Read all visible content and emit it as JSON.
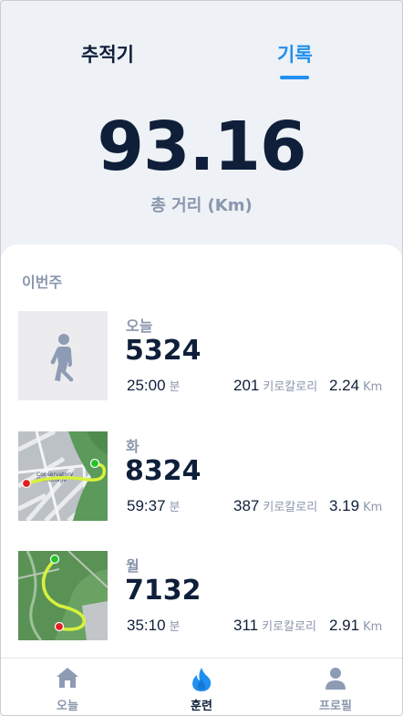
{
  "header": {
    "tabs": [
      {
        "label": "추적기",
        "active": false
      },
      {
        "label": "기록",
        "active": true
      }
    ]
  },
  "summary": {
    "total_distance": "93.16",
    "total_label": "총 거리 (Km)"
  },
  "week": {
    "title": "이번주",
    "records": [
      {
        "day": "오늘",
        "steps": "5324",
        "time": "25:00",
        "time_unit": "분",
        "kcal": "201",
        "kcal_unit": "키로칼로리",
        "distance": "2.24",
        "distance_unit": "Km",
        "thumbnail": "walking-person-icon"
      },
      {
        "day": "화",
        "steps": "8324",
        "time": "59:37",
        "time_unit": "분",
        "kcal": "387",
        "kcal_unit": "키로칼로리",
        "distance": "3.19",
        "distance_unit": "Km",
        "thumbnail": "route-map"
      },
      {
        "day": "월",
        "steps": "7132",
        "time": "35:10",
        "time_unit": "분",
        "kcal": "311",
        "kcal_unit": "키로칼로리",
        "distance": "2.91",
        "distance_unit": "Km",
        "thumbnail": "route-map"
      }
    ]
  },
  "bottom_nav": {
    "items": [
      {
        "label": "오늘",
        "icon": "home-icon",
        "active": false
      },
      {
        "label": "훈련",
        "icon": "flame-icon",
        "active": true
      },
      {
        "label": "프로필",
        "icon": "user-icon",
        "active": false
      }
    ]
  },
  "colors": {
    "accent": "#1f8ff0",
    "text_dark": "#0f1f3a",
    "text_muted": "#8a97ad",
    "background": "#eef1f5",
    "route_line": "#d8f23c",
    "start_marker": "#22c32a",
    "end_marker": "#e02020"
  }
}
